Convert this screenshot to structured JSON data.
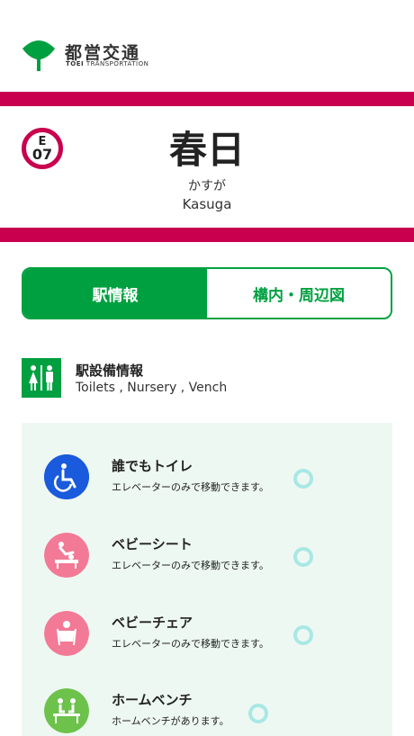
{
  "header": {
    "logo_ja": "都営交通",
    "logo_en_bold": "TOEI",
    "logo_en_rest": " TRANSPORTATION",
    "brand_color": "#00a040"
  },
  "station": {
    "line_letter": "E",
    "line_number": "07",
    "line_color": "#c8004e",
    "name_ja": "春日",
    "name_kana": "かすが",
    "name_en": "Kasuga"
  },
  "tabs": [
    {
      "label": "駅情報",
      "active": true
    },
    {
      "label": "構内・周辺図",
      "active": false
    }
  ],
  "section": {
    "icon": "restroom-icon",
    "title": "駅設備情報",
    "subtitle": "Toilets , Nursery , Vench"
  },
  "facilities": [
    {
      "icon": "wheelchair-icon",
      "name": "誰でもトイレ",
      "desc": "エレベーターのみで移動できます。",
      "availability": "○",
      "color": "#1a5adc"
    },
    {
      "icon": "diaper-change-icon",
      "name": "ベビーシート",
      "desc": "エレベーターのみで移動できます。",
      "availability": "○",
      "color": "#f27a96"
    },
    {
      "icon": "baby-chair-icon",
      "name": "ベビーチェア",
      "desc": "エレベーターのみで移動できます。",
      "availability": "○",
      "color": "#f27a96"
    },
    {
      "icon": "bench-icon",
      "name": "ホームベンチ",
      "desc": "ホームベンチがあります。",
      "availability": "○",
      "color": "#6cc24a"
    }
  ]
}
